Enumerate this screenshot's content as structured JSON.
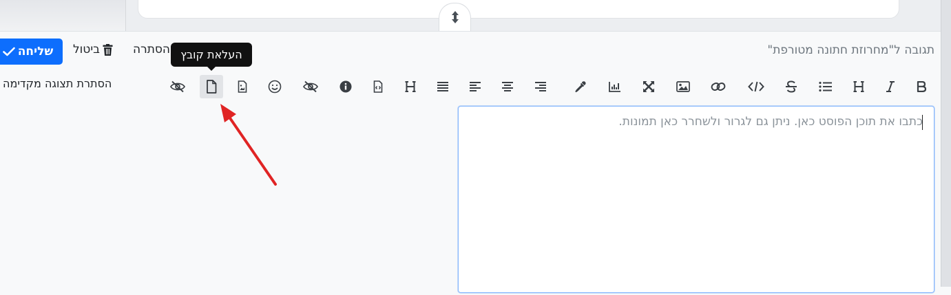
{
  "reply": {
    "title": "תגובה ל\"מחרוזת חתונה מטורפת\"",
    "send_label": "שליחה",
    "discard_label": "ביטול",
    "hide_label": "הסתרה",
    "hide_preview_label": "הסתרת תצוגה מקדימה"
  },
  "toolbar": {
    "buttons": [
      {
        "name": "bold",
        "icon": "B"
      },
      {
        "name": "italic",
        "icon": "I"
      },
      {
        "name": "heading",
        "icon": "H"
      },
      {
        "name": "bulleted-list",
        "icon": "list-icon"
      },
      {
        "name": "strikethrough",
        "icon": "S"
      },
      {
        "name": "code",
        "icon": "</>"
      },
      {
        "name": "link",
        "icon": "link-icon"
      },
      {
        "name": "image",
        "icon": "image-icon"
      },
      {
        "name": "fullscreen",
        "icon": "expand-icon"
      },
      {
        "name": "chart",
        "icon": "chart-icon"
      },
      {
        "name": "color-picker",
        "icon": "eyedropper-icon"
      },
      {
        "name": "align-right",
        "icon": "align-right-icon"
      },
      {
        "name": "align-center",
        "icon": "align-center-icon"
      },
      {
        "name": "align-left",
        "icon": "align-left-icon"
      },
      {
        "name": "justify",
        "icon": "justify-icon"
      },
      {
        "name": "heading-alt",
        "icon": "H"
      },
      {
        "name": "code-file",
        "icon": "code-file-icon"
      },
      {
        "name": "info",
        "icon": "i"
      },
      {
        "name": "spoiler",
        "icon": "eye-slash-icon"
      },
      {
        "name": "emoji",
        "icon": "smile-icon"
      },
      {
        "name": "image-file",
        "icon": "image-file-icon"
      },
      {
        "name": "upload-file",
        "icon": "file-icon"
      },
      {
        "name": "hide-content",
        "icon": "eye-slash-icon"
      }
    ],
    "tooltip": "העלאת קובץ"
  },
  "editor": {
    "placeholder": "כתבו את תוכן הפוסט כאן. ניתן גם לגרור ולשחרר כאן תמונות.",
    "value": ""
  },
  "colors": {
    "primary": "#0d6efd",
    "annotation_arrow": "#e02424",
    "tooltip_bg": "#111111"
  }
}
